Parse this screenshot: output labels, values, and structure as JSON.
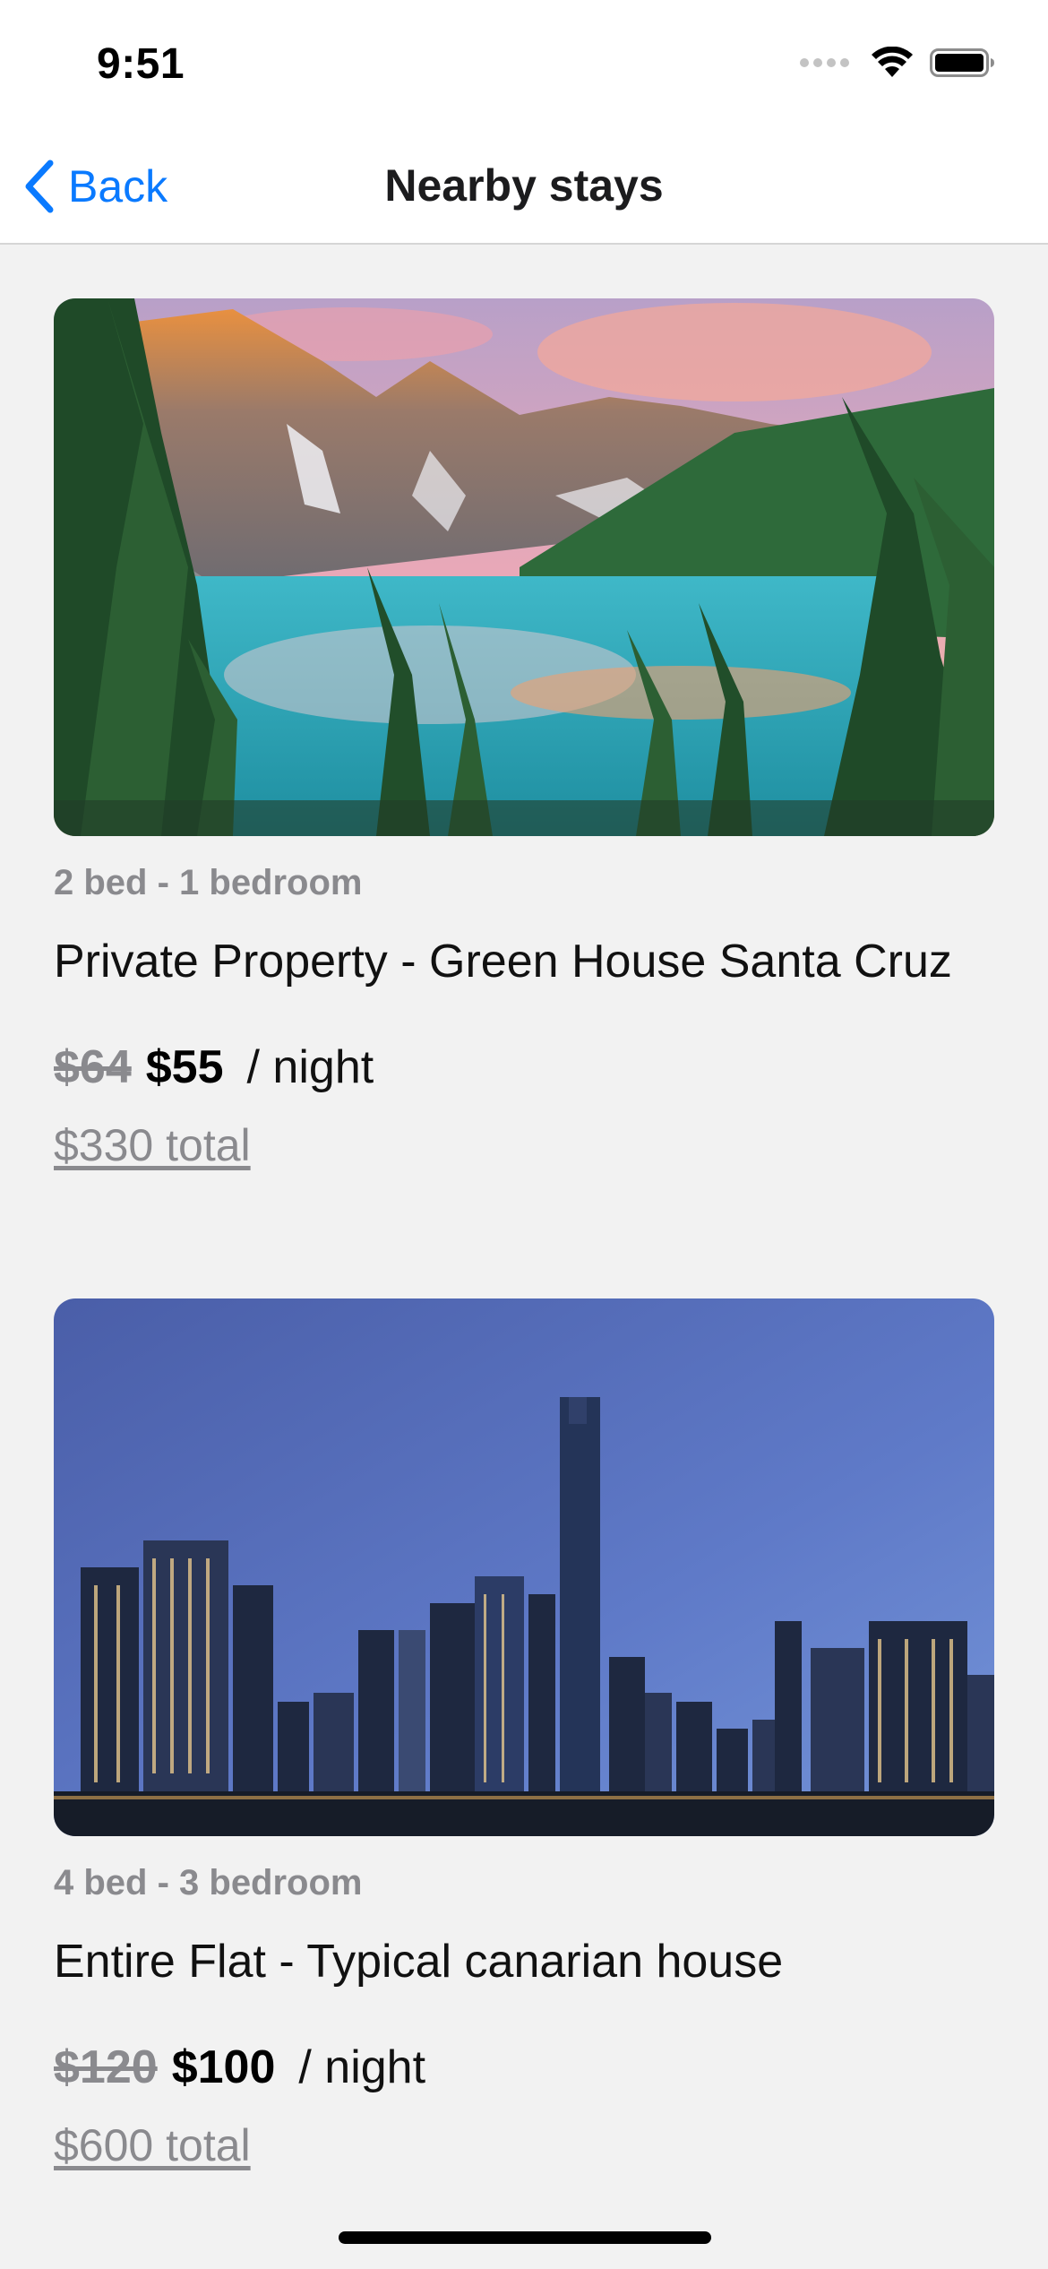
{
  "status_bar": {
    "time": "9:51",
    "icons": [
      "signal-icon",
      "wifi-icon",
      "battery-icon"
    ]
  },
  "nav": {
    "back_label": "Back",
    "title": "Nearby stays"
  },
  "listings": [
    {
      "image": "mountain-lake-photo",
      "meta": "2 bed - 1 bedroom",
      "title": "Private Property - Green House Santa Cruz",
      "old_price": "$64",
      "price": "$55",
      "per_night": "/ night",
      "total": "$330 total"
    },
    {
      "image": "city-skyline-photo",
      "meta": "4 bed - 3 bedroom",
      "title": "Entire Flat - Typical canarian house",
      "old_price": "$120",
      "price": "$100",
      "per_night": "/ night",
      "total": "$600 total"
    }
  ],
  "colors": {
    "accent": "#0a7aff",
    "background": "#f2f2f2",
    "muted_text": "#8a8a8e"
  }
}
